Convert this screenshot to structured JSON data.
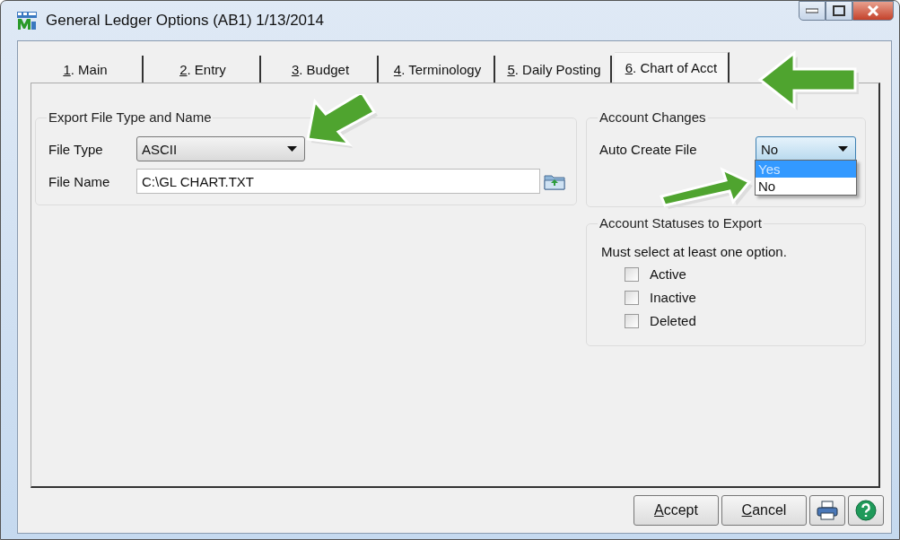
{
  "window": {
    "title": "General Ledger Options (AB1) 1/13/2014"
  },
  "tabs": [
    {
      "accel": "1",
      "label": ". Main",
      "selected": false
    },
    {
      "accel": "2",
      "label": ". Entry",
      "selected": false
    },
    {
      "accel": "3",
      "label": ". Budget",
      "selected": false
    },
    {
      "accel": "4",
      "label": ". Terminology",
      "selected": false
    },
    {
      "accel": "5",
      "label": ". Daily Posting",
      "selected": false
    },
    {
      "accel": "6",
      "label": ". Chart of Acct",
      "selected": true
    }
  ],
  "export_group": {
    "title": "Export File Type and Name",
    "file_type": {
      "label": "File Type",
      "value": "ASCII"
    },
    "file_name": {
      "label": "File Name",
      "value": "C:\\GL CHART.TXT"
    }
  },
  "account_changes": {
    "title": "Account Changes",
    "auto_create_file": {
      "label": "Auto Create File",
      "value": "No",
      "expanded": true,
      "options": [
        {
          "label": "Yes",
          "highlighted": true
        },
        {
          "label": "No",
          "highlighted": false
        }
      ]
    }
  },
  "account_statuses": {
    "title": "Account Statuses to Export",
    "hint": "Must select at least one option.",
    "options": [
      {
        "label": "Active",
        "checked": false
      },
      {
        "label": "Inactive",
        "checked": false
      },
      {
        "label": "Deleted",
        "checked": false
      }
    ]
  },
  "buttons": [
    {
      "accel": "A",
      "label": "ccept"
    },
    {
      "accel": "C",
      "label": "ancel"
    }
  ]
}
